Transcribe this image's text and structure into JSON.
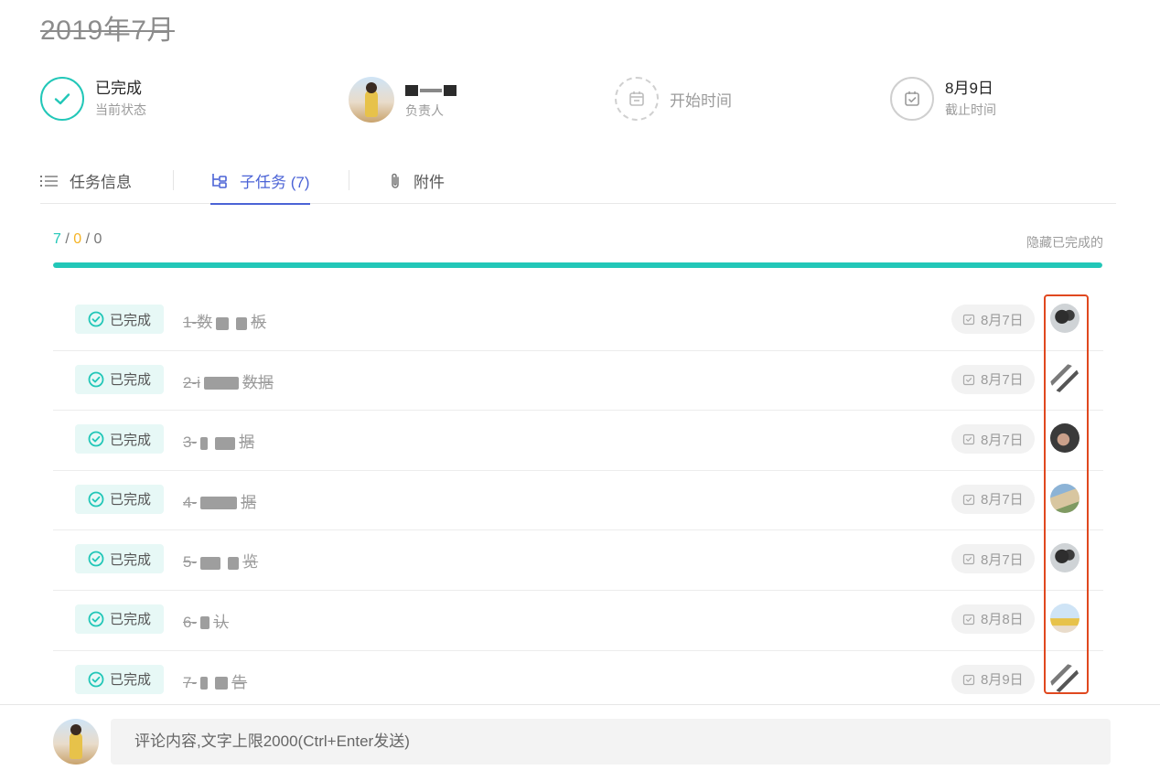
{
  "page": {
    "title": "2019年7月"
  },
  "info": {
    "status": {
      "value": "已完成",
      "label": "当前状态",
      "icon": "check-circle-icon"
    },
    "owner": {
      "label": "负责人"
    },
    "start": {
      "placeholder": "开始时间",
      "icon": "calendar-icon"
    },
    "deadline": {
      "value": "8月9日",
      "label": "截止时间",
      "icon": "calendar-check-icon"
    }
  },
  "tabs": [
    {
      "label": "任务信息",
      "icon": "list-icon",
      "active": false
    },
    {
      "label": "子任务 (7)",
      "icon": "subtask-icon",
      "active": true
    },
    {
      "label": "附件",
      "icon": "paperclip-icon",
      "active": false
    }
  ],
  "summary": {
    "done": "7",
    "in_progress": "0",
    "todo": "0",
    "separator": " / ",
    "hide_done": "隐藏已完成的",
    "progress_fraction": 1.0
  },
  "subtasks": [
    {
      "status": "已完成",
      "title_prefix": "1-数",
      "title_suffix": "板",
      "date": "8月7日",
      "avatar": "av-a"
    },
    {
      "status": "已完成",
      "title_prefix": "2-i",
      "title_suffix": "数据",
      "date": "8月7日",
      "avatar": "av-b"
    },
    {
      "status": "已完成",
      "title_prefix": "3-",
      "title_suffix": "据",
      "date": "8月7日",
      "avatar": "av-c"
    },
    {
      "status": "已完成",
      "title_prefix": "4-",
      "title_suffix": "据",
      "date": "8月7日",
      "avatar": "av-d"
    },
    {
      "status": "已完成",
      "title_prefix": "5-",
      "title_suffix": "览",
      "date": "8月7日",
      "avatar": "av-a"
    },
    {
      "status": "已完成",
      "title_prefix": "6-",
      "title_suffix": "认",
      "date": "8月8日",
      "avatar": "av-e"
    },
    {
      "status": "已完成",
      "title_prefix": "7-",
      "title_suffix": "告",
      "date": "8月9日",
      "avatar": "av-b"
    }
  ],
  "comment": {
    "placeholder": "评论内容,文字上限2000(Ctrl+Enter发送)"
  },
  "colors": {
    "accent_teal": "#22c7b8",
    "accent_blue": "#4b63d6",
    "accent_orange": "#f5b324",
    "highlight_red": "#e0481f"
  }
}
